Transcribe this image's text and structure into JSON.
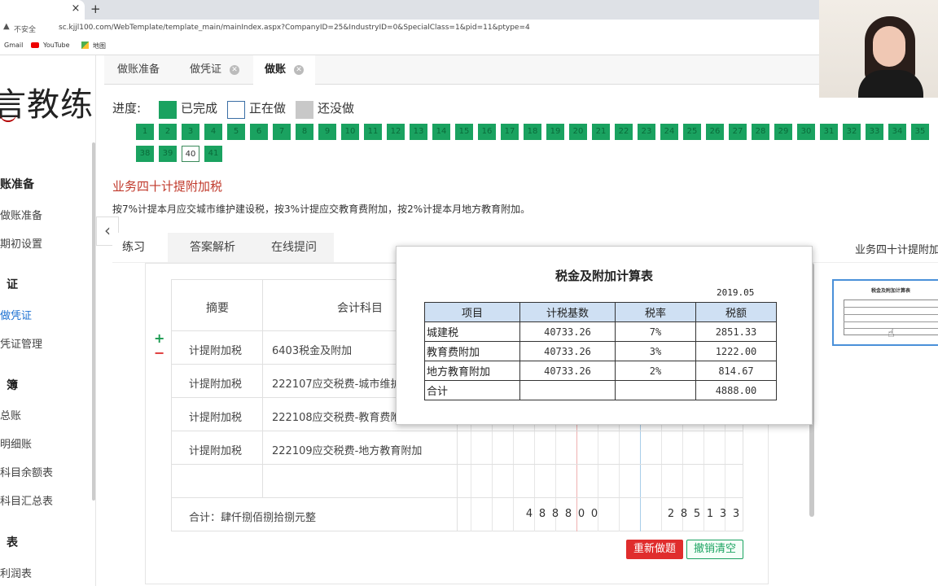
{
  "browser": {
    "tab_close": "×",
    "new_tab": "+",
    "security_label": "不安全",
    "url": "sc.kjjl100.com/WebTemplate/template_main/mainIndex.aspx?CompanyID=25&IndustryID=0&SpecialClass=1&pid=11&ptype=4",
    "bookmarks": [
      "Gmail",
      "YouTube",
      "地图"
    ]
  },
  "sidebar": {
    "logo": "言教练",
    "sections": [
      {
        "head": "账准备",
        "items": [
          "做账准备",
          "期初设置"
        ]
      },
      {
        "head": "证",
        "items": [
          "做凭证",
          "凭证管理"
        ]
      },
      {
        "head": "簿",
        "items": [
          "总账",
          "明细账",
          "科目余额表",
          "科目汇总表"
        ]
      },
      {
        "head": "表",
        "items": [
          "利润表"
        ]
      }
    ],
    "collapse_glyph": "‹"
  },
  "top_tabs": [
    "做账准备",
    "做凭证",
    "做账"
  ],
  "progress": {
    "label": "进度:",
    "legend": [
      "已完成",
      "正在做",
      "还没做"
    ],
    "current": 40,
    "numbers": [
      "1",
      "2",
      "3",
      "4",
      "5",
      "6",
      "7",
      "8",
      "9",
      "10",
      "11",
      "12",
      "13",
      "14",
      "15",
      "16",
      "17",
      "18",
      "19",
      "20",
      "21",
      "22",
      "23",
      "24",
      "25",
      "26",
      "27",
      "28",
      "29",
      "30",
      "31",
      "32",
      "33",
      "34",
      "35",
      "38",
      "39",
      "40",
      "41"
    ]
  },
  "task": {
    "title": "业务四十计提附加税",
    "description": "按7%计提本月应交城市维护建设税，按3%计提应交教育费附加，按2%计提本月地方教育附加。"
  },
  "sub_tabs": [
    "练习",
    "答案解析",
    "在线提问"
  ],
  "right_panel_title": "业务四十计提附加",
  "voucher": {
    "headers": {
      "summary": "摘要",
      "account": "会计科目"
    },
    "rows": [
      {
        "summary": "计提附加税",
        "account": "6403税金及附加"
      },
      {
        "summary": "计提附加税",
        "account": "222107应交税费-城市维护"
      },
      {
        "summary": "计提附加税",
        "account": "222108应交税费-教育费附"
      },
      {
        "summary": "计提附加税",
        "account": "222109应交税费-地方教育附加"
      }
    ],
    "total_label": "合计：肆仟捌佰捌拾捌元整",
    "debit_digits": [
      "4",
      "8",
      "8",
      "8",
      "0",
      "0"
    ],
    "credit_digits": [
      "2",
      "8",
      "5",
      "1",
      "3",
      "3"
    ],
    "plus": "+",
    "minus": "−"
  },
  "buttons": {
    "redo": "重新做题",
    "clear": "撤销清空"
  },
  "popup": {
    "title": "税金及附加计算表",
    "date": "2019.05",
    "headers": [
      "项目",
      "计税基数",
      "税率",
      "税额"
    ],
    "rows": [
      [
        "城建税",
        "40733.26",
        "7%",
        "2851.33"
      ],
      [
        "教育费附加",
        "40733.26",
        "3%",
        "1222.00"
      ],
      [
        "地方教育附加",
        "40733.26",
        "2%",
        "814.67"
      ],
      [
        "合计",
        "",
        "",
        "4888.00"
      ]
    ]
  },
  "thumbnail": {
    "title": "税金及附加计算表"
  },
  "colors": {
    "done": "#1aa260",
    "task_title": "#c0392b",
    "redo": "#e02d2d",
    "popup_header": "#cfe0f3"
  }
}
